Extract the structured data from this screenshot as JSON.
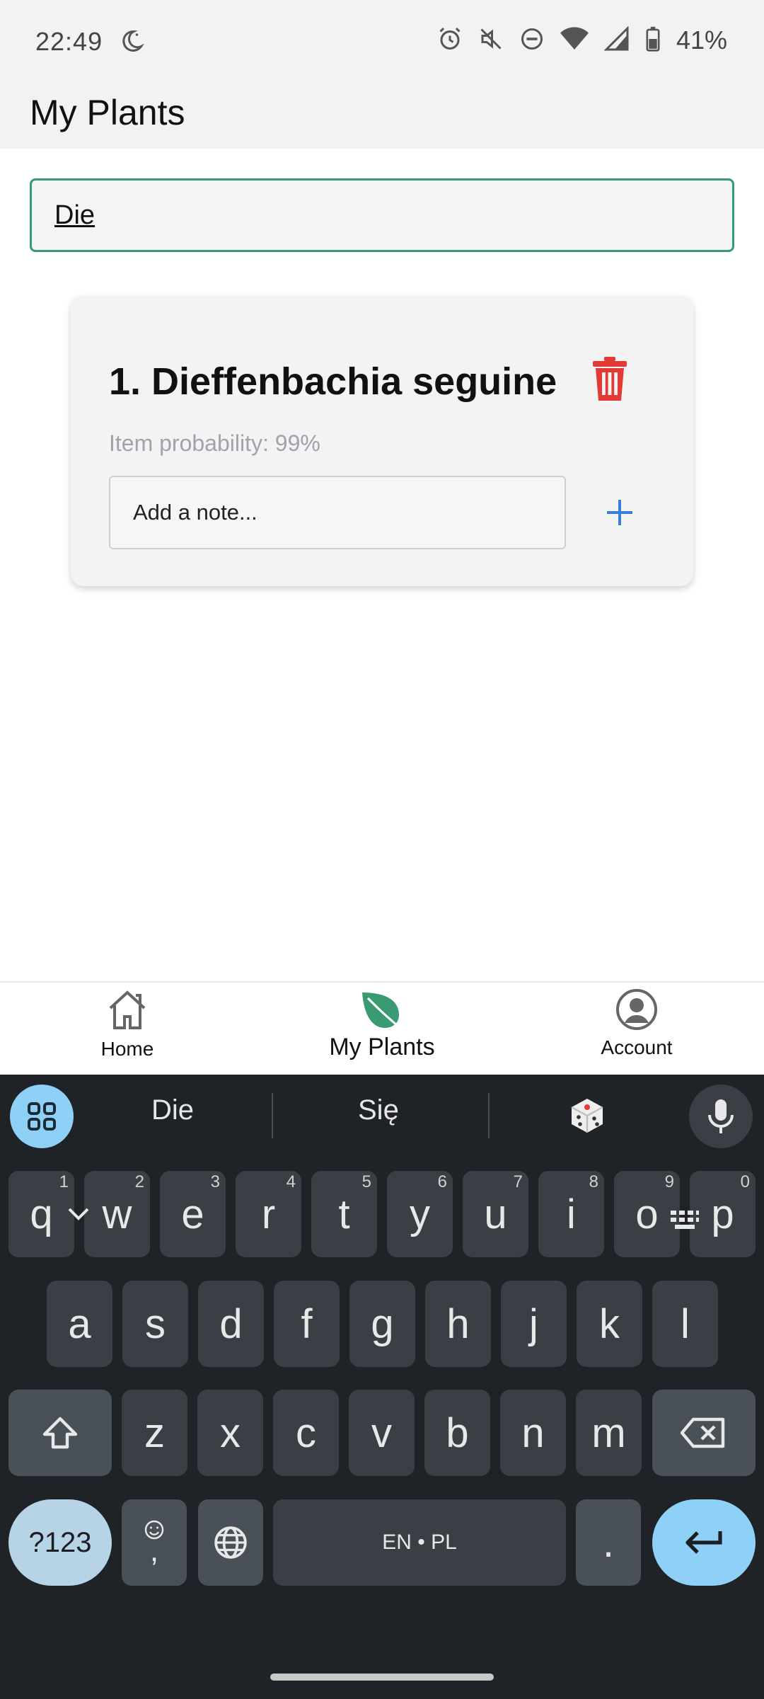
{
  "status_bar": {
    "time": "22:49",
    "battery": "41%",
    "icons": [
      "moon-icon",
      "alarm-icon",
      "mute-icon",
      "dnd-icon",
      "wifi-icon",
      "signal-icon",
      "battery-icon"
    ]
  },
  "app_bar": {
    "title": "My Plants"
  },
  "search": {
    "value": "Die"
  },
  "plants": [
    {
      "name": "1. Dieffenbachia seguine",
      "probability": "Item probability: 99%",
      "note_placeholder": "Add a note..."
    }
  ],
  "bottom_nav": {
    "items": [
      {
        "label": "Home",
        "icon": "home-icon",
        "active": false
      },
      {
        "label": "My Plants",
        "icon": "leaf-icon",
        "active": true
      },
      {
        "label": "Account",
        "icon": "account-icon",
        "active": false
      }
    ]
  },
  "keyboard": {
    "suggestions": [
      "Die",
      "Się"
    ],
    "row1": [
      {
        "key": "q",
        "hint": "1"
      },
      {
        "key": "w",
        "hint": "2"
      },
      {
        "key": "e",
        "hint": "3"
      },
      {
        "key": "r",
        "hint": "4"
      },
      {
        "key": "t",
        "hint": "5"
      },
      {
        "key": "y",
        "hint": "6"
      },
      {
        "key": "u",
        "hint": "7"
      },
      {
        "key": "i",
        "hint": "8"
      },
      {
        "key": "o",
        "hint": "9"
      },
      {
        "key": "p",
        "hint": "0"
      }
    ],
    "row2": [
      "a",
      "s",
      "d",
      "f",
      "g",
      "h",
      "j",
      "k",
      "l"
    ],
    "row3": [
      "z",
      "x",
      "c",
      "v",
      "b",
      "n",
      "m"
    ],
    "symbols_label": "?123",
    "comma_label": ",",
    "space_label": "EN • PL",
    "period_label": "."
  },
  "colors": {
    "accent_green": "#3a9a72",
    "delete_red": "#e53935",
    "add_blue": "#3b7ddd",
    "keyboard_bg": "#1f2328",
    "keyboard_accent": "#8fd0f7"
  }
}
